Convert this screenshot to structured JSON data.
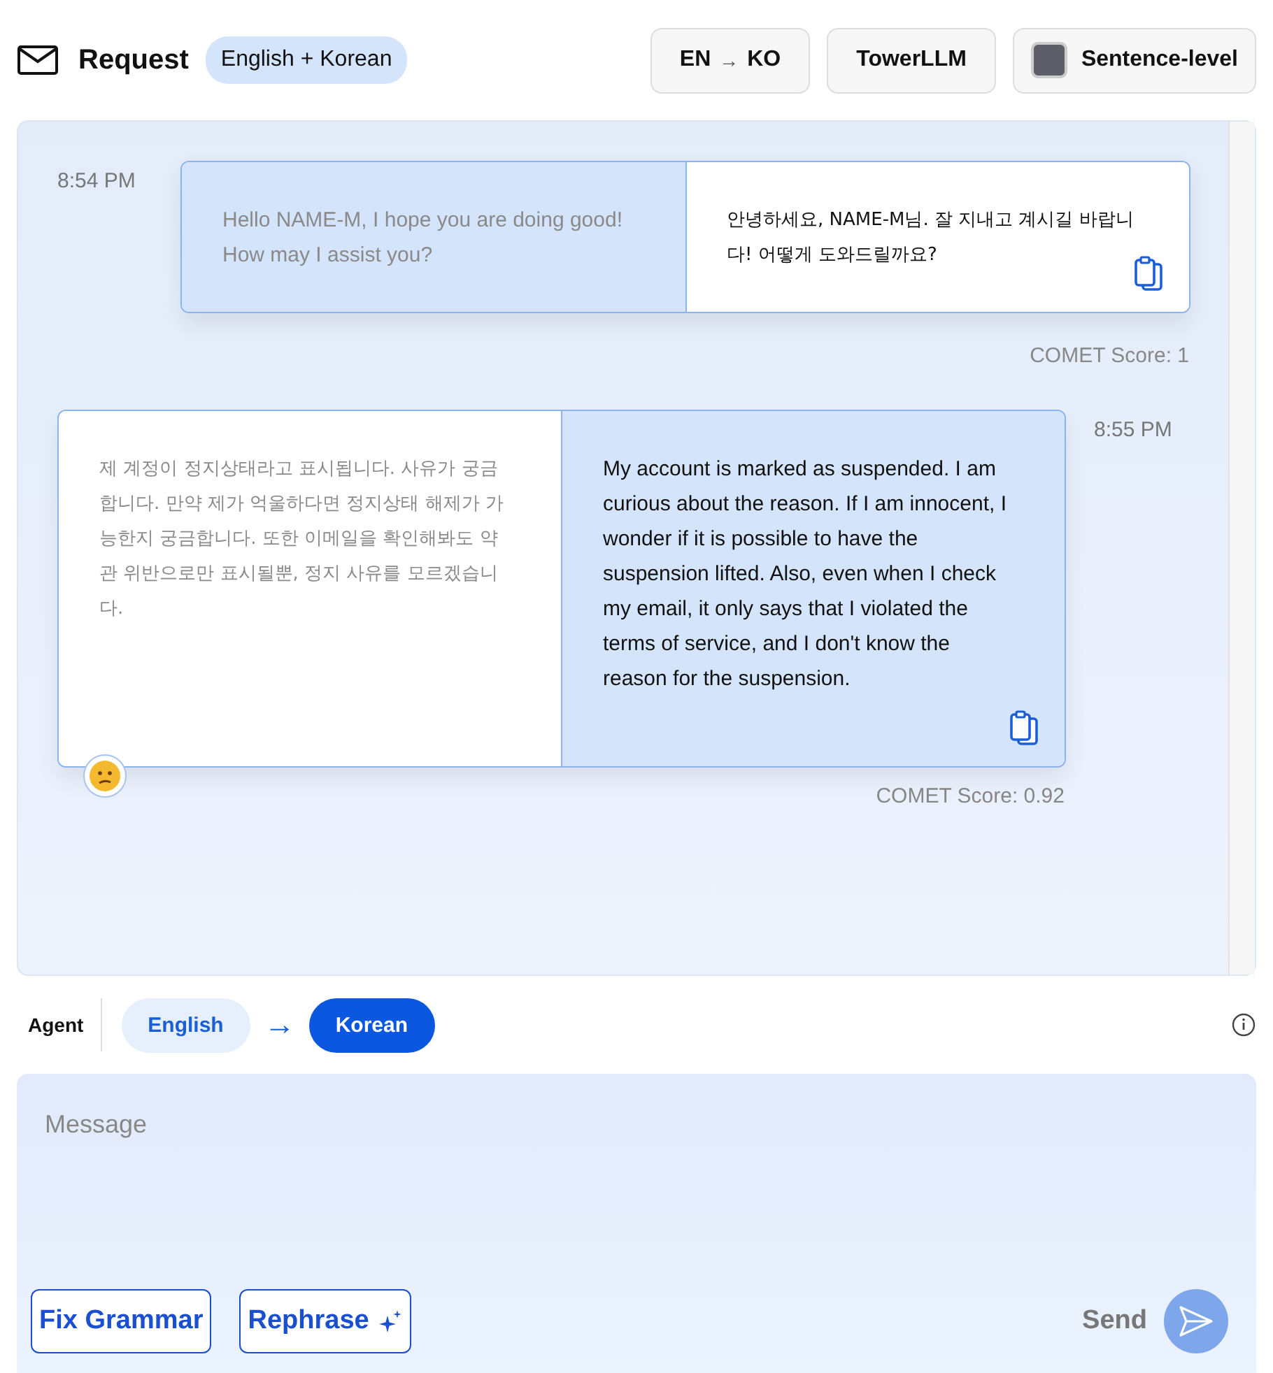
{
  "header": {
    "title": "Request",
    "language_badge": "English + Korean",
    "buttons": [
      {
        "kind": "direction",
        "from": "EN",
        "arrow": "→",
        "to": "KO"
      },
      {
        "kind": "plain",
        "label": "TowerLLM"
      },
      {
        "kind": "swatch",
        "label": "Sentence-level"
      }
    ]
  },
  "messages": [
    {
      "kind": "received",
      "time": "8:54 PM",
      "panes": [
        {
          "text": "Hello NAME-M, I hope you are doing good! How may I assist you?",
          "muted": true,
          "tinted": true,
          "copy": false
        },
        {
          "text": "안녕하세요, NAME-M님. 잘 지내고 계시길 바랍니다! 어떻게 도와드릴까요?",
          "muted": false,
          "tinted": false,
          "copy": true
        }
      ],
      "score": "COMET Score: 1"
    },
    {
      "kind": "sent",
      "time": "8:55 PM",
      "panes": [
        {
          "text": "제 계정이 정지상태라고 표시됩니다. 사유가 궁금합니다. 만약 제가 억울하다면 정지상태 해제가 가능한지 궁금합니다. 또한 이메일을 확인해봐도 약관 위반으로만 표시될뿐, 정지 사유를 모르겠습니다.",
          "muted": true,
          "tinted": false,
          "copy": false
        },
        {
          "text": "My account is marked as suspended. I am curious about the reason. If I am innocent, I wonder if it is possible to have the suspension lifted. Also, even when I check my email, it only says that I violated the terms of service, and I don't know the reason for the suspension.",
          "muted": false,
          "tinted": true,
          "copy": true
        }
      ],
      "score": "COMET Score: 0.92",
      "reaction": {
        "kind": "confused"
      }
    }
  ],
  "agent": {
    "label": "Agent",
    "languages": [
      {
        "label": "English",
        "selected": false
      },
      {
        "label": "Korean",
        "selected": true
      }
    ],
    "arrow": "→"
  },
  "composer": {
    "placeholder": "Message",
    "actions": [
      {
        "label": "Fix Grammar",
        "sparkle": false
      },
      {
        "label": "Rephrase",
        "sparkle": true
      }
    ],
    "send_label": "Send",
    "send_disabled": true
  }
}
